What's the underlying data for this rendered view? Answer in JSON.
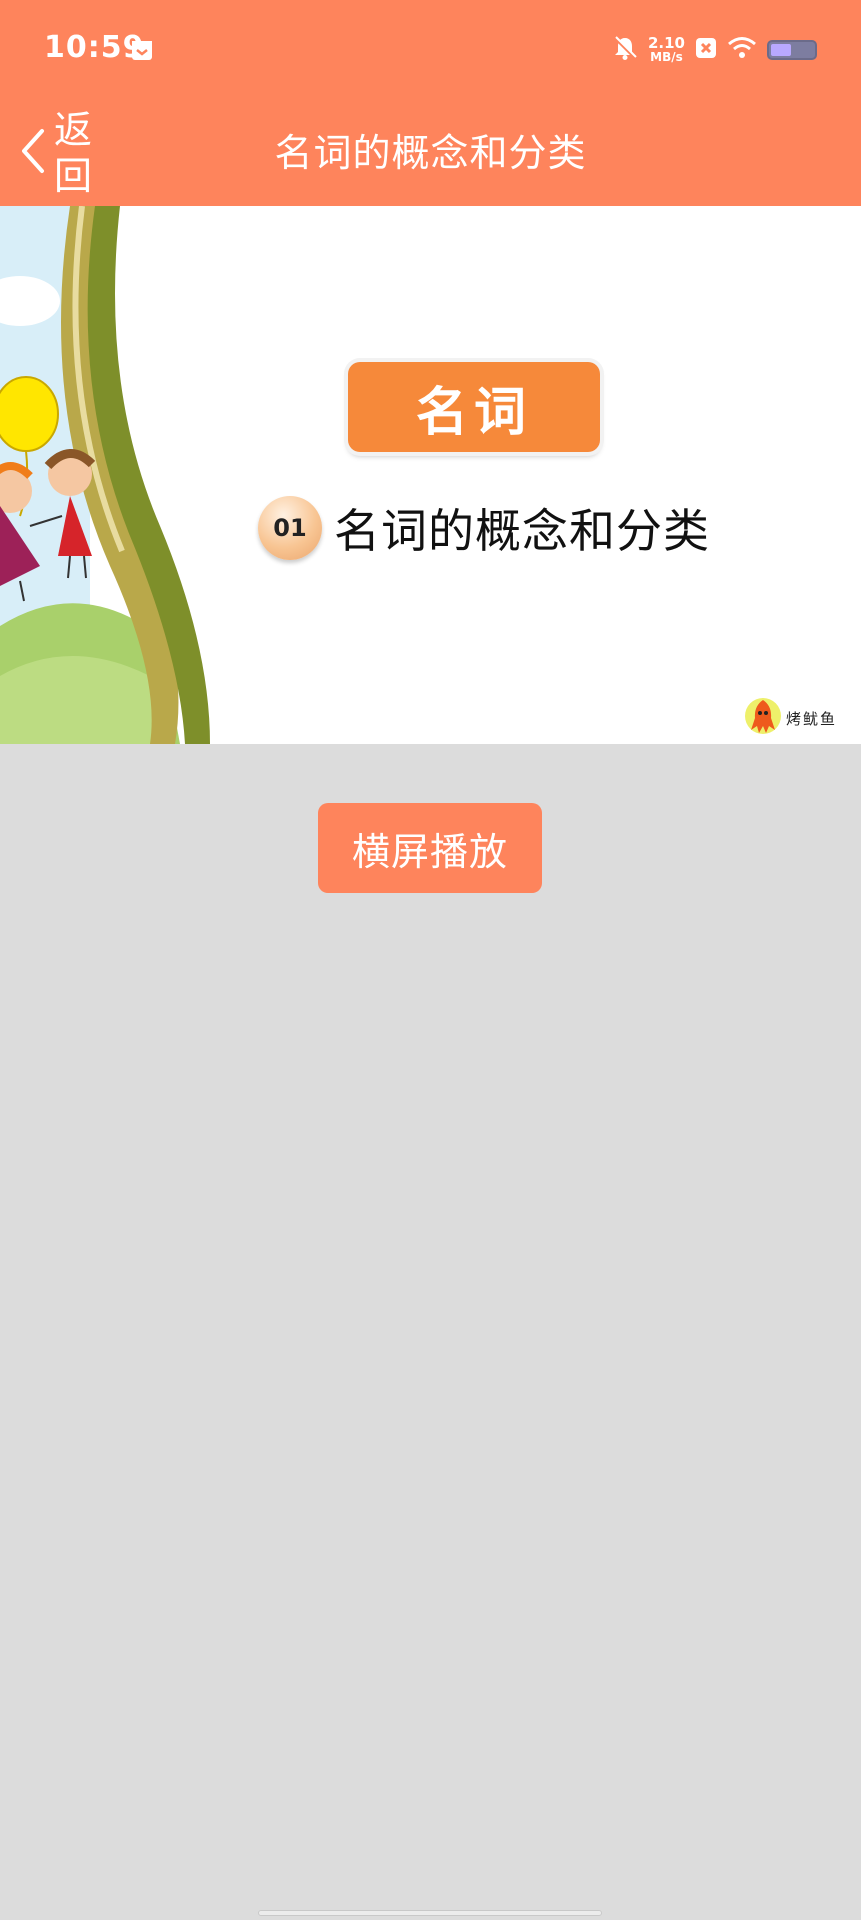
{
  "status_bar": {
    "time": "10:59",
    "net_speed_value": "2.10",
    "net_speed_unit": "MB/s",
    "icons": [
      "calendar-notification-icon",
      "mute-bell-icon",
      "close-notification-icon",
      "wifi-icon",
      "battery-icon"
    ]
  },
  "app_bar": {
    "back_label": "返回",
    "title": "名词的概念和分类"
  },
  "video": {
    "badge": "名词",
    "lesson_number": "01",
    "lesson_title": "名词的概念和分类",
    "brand": "烤鱿鱼"
  },
  "actions": {
    "landscape_label": "横屏播放"
  },
  "colors": {
    "accent": "#fe845c",
    "badge": "#f6893a",
    "background": "#dcdcdc"
  }
}
